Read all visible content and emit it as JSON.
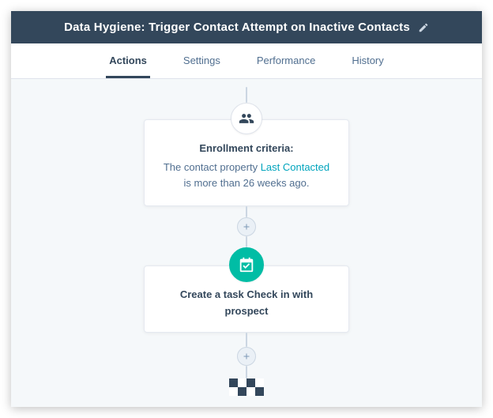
{
  "header": {
    "title": "Data Hygiene: Trigger Contact Attempt on Inactive Contacts"
  },
  "tabs": [
    {
      "id": "actions",
      "label": "Actions",
      "active": true
    },
    {
      "id": "settings",
      "label": "Settings",
      "active": false
    },
    {
      "id": "performance",
      "label": "Performance",
      "active": false
    },
    {
      "id": "history",
      "label": "History",
      "active": false
    }
  ],
  "enrollment": {
    "heading": "Enrollment criteria:",
    "body_prefix": "The contact property ",
    "link_text": "Last Contacted",
    "body_suffix": " is more than 26 weeks ago."
  },
  "action1": {
    "heading": "Create a task Check in with prospect"
  }
}
